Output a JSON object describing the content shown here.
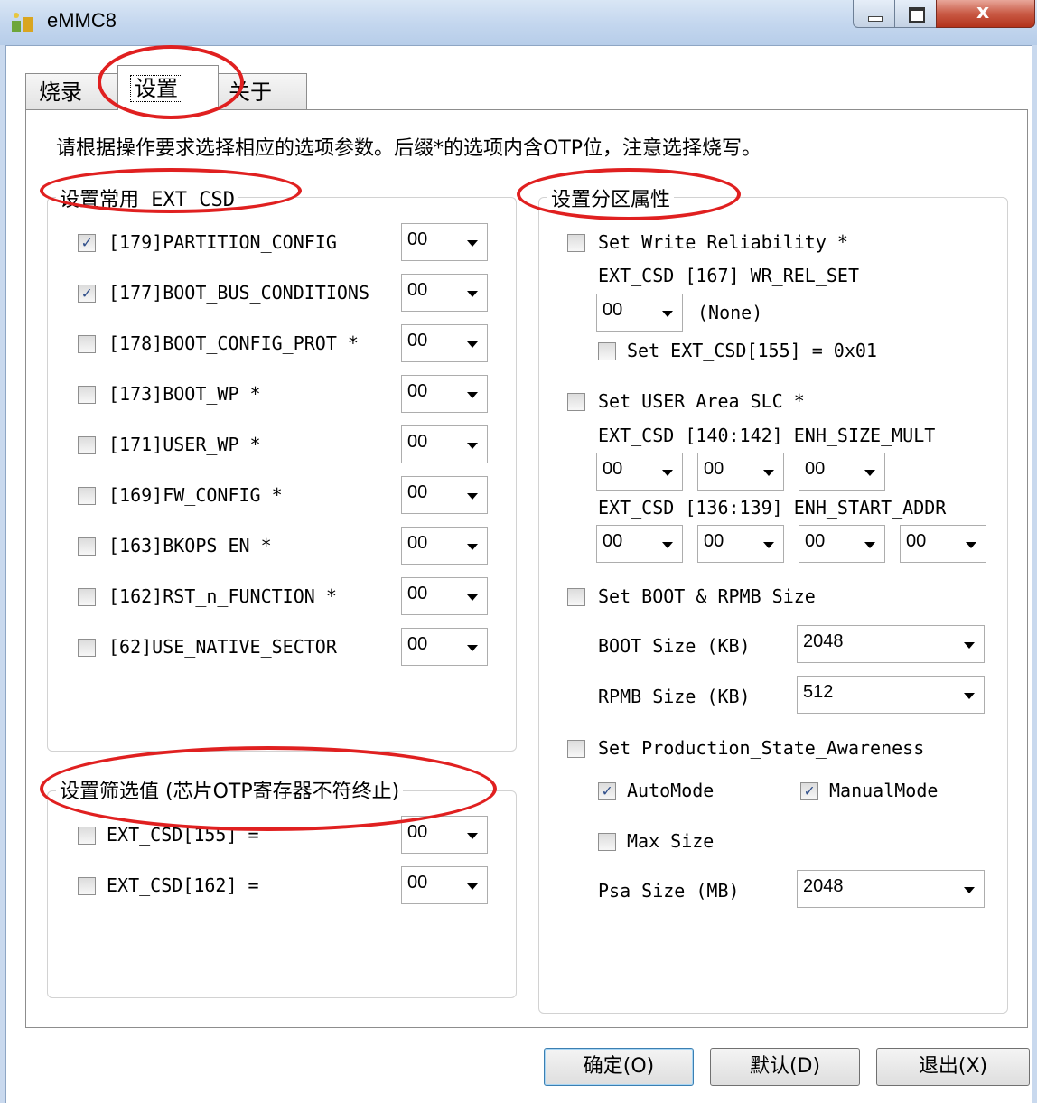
{
  "window": {
    "title": "eMMC8",
    "annotation_color": "#e02020"
  },
  "tabs": [
    "烧录",
    "设置",
    "关于"
  ],
  "instruction": "请根据操作要求选择相应的选项参数。后缀*的选项内含OTP位，注意选择烧写。",
  "ext_csd_group": {
    "title": "设置常用 EXT_CSD",
    "items": [
      {
        "label": "[179]PARTITION_CONFIG",
        "checked": "✓",
        "value": "00"
      },
      {
        "label": "[177]BOOT_BUS_CONDITIONS",
        "checked": "✓",
        "value": "00"
      },
      {
        "label": "[178]BOOT_CONFIG_PROT *",
        "checked": "",
        "value": "00"
      },
      {
        "label": "[173]BOOT_WP *",
        "checked": "",
        "value": "00"
      },
      {
        "label": "[171]USER_WP *",
        "checked": "",
        "value": "00"
      },
      {
        "label": "[169]FW_CONFIG *",
        "checked": "",
        "value": "00"
      },
      {
        "label": "[163]BKOPS_EN *",
        "checked": "",
        "value": "00"
      },
      {
        "label": "[162]RST_n_FUNCTION *",
        "checked": "",
        "value": "00"
      },
      {
        "label": "[62]USE_NATIVE_SECTOR",
        "checked": "",
        "value": "00"
      }
    ]
  },
  "filter_group": {
    "title": "设置筛选值 (芯片OTP寄存器不符终止)",
    "items": [
      {
        "label": "EXT_CSD[155] =",
        "value": "00"
      },
      {
        "label": "EXT_CSD[162] =",
        "value": "00"
      }
    ]
  },
  "partition_group": {
    "title": "设置分区属性",
    "write_reliability": {
      "label": "Set Write Reliability *",
      "sub_label": "EXT_CSD [167] WR_REL_SET",
      "value": "00",
      "value_desc": "(None)",
      "set155_label": "Set EXT_CSD[155] = 0x01"
    },
    "user_slc": {
      "label": "Set USER Area SLC *",
      "size_label": "EXT_CSD [140:142] ENH_SIZE_MULT",
      "size_values": [
        "00",
        "00",
        "00"
      ],
      "addr_label": "EXT_CSD [136:139] ENH_START_ADDR",
      "addr_values": [
        "00",
        "00",
        "00",
        "00"
      ]
    },
    "boot_rpmb": {
      "label": "Set BOOT & RPMB Size",
      "boot_label": "BOOT Size (KB)",
      "boot_value": "2048",
      "rpmb_label": "RPMB Size (KB)",
      "rpmb_value": "512"
    },
    "psa": {
      "label": "Set Production_State_Awareness",
      "auto_label": "AutoMode",
      "auto_checked": "✓",
      "manual_label": "ManualMode",
      "manual_checked": "✓",
      "max_label": "Max Size",
      "psa_label": "Psa Size (MB)",
      "psa_value": "2048"
    }
  },
  "buttons": {
    "ok": "确定(O)",
    "default": "默认(D)",
    "exit": "退出(X)"
  }
}
